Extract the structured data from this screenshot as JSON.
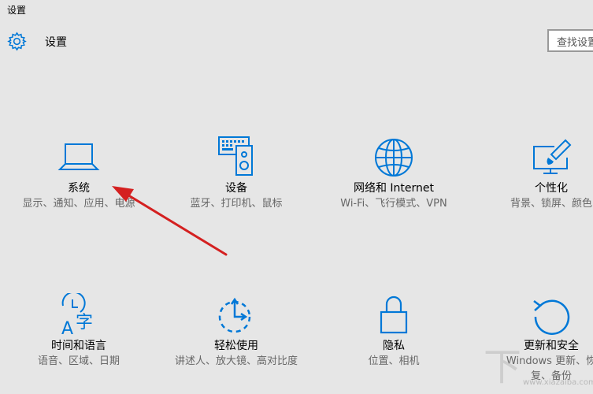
{
  "window": {
    "title": "设置"
  },
  "header": {
    "title": "设置",
    "search_placeholder": "查找设置"
  },
  "accent_color": "#0078d7",
  "tiles": [
    {
      "title": "系统",
      "desc": "显示、通知、应用、电源",
      "icon": "laptop-icon"
    },
    {
      "title": "设备",
      "desc": "蓝牙、打印机、鼠标",
      "icon": "keyboard-speaker-icon"
    },
    {
      "title": "网络和 Internet",
      "desc": "Wi-Fi、飞行模式、VPN",
      "icon": "globe-icon"
    },
    {
      "title": "个性化",
      "desc": "背景、锁屏、颜色",
      "icon": "paint-monitor-icon"
    },
    {
      "title": "时间和语言",
      "desc": "语音、区域、日期",
      "icon": "clock-language-icon"
    },
    {
      "title": "轻松使用",
      "desc": "讲述人、放大镜、高对比度",
      "icon": "ease-of-access-icon"
    },
    {
      "title": "隐私",
      "desc": "位置、相机",
      "icon": "lock-icon"
    },
    {
      "title": "更新和安全",
      "desc": "Windows 更新、恢复、备份",
      "icon": "refresh-icon"
    }
  ],
  "annotation": {
    "arrow_color": "#d42020"
  },
  "watermark": {
    "url": "www.xiazaiba.com"
  }
}
